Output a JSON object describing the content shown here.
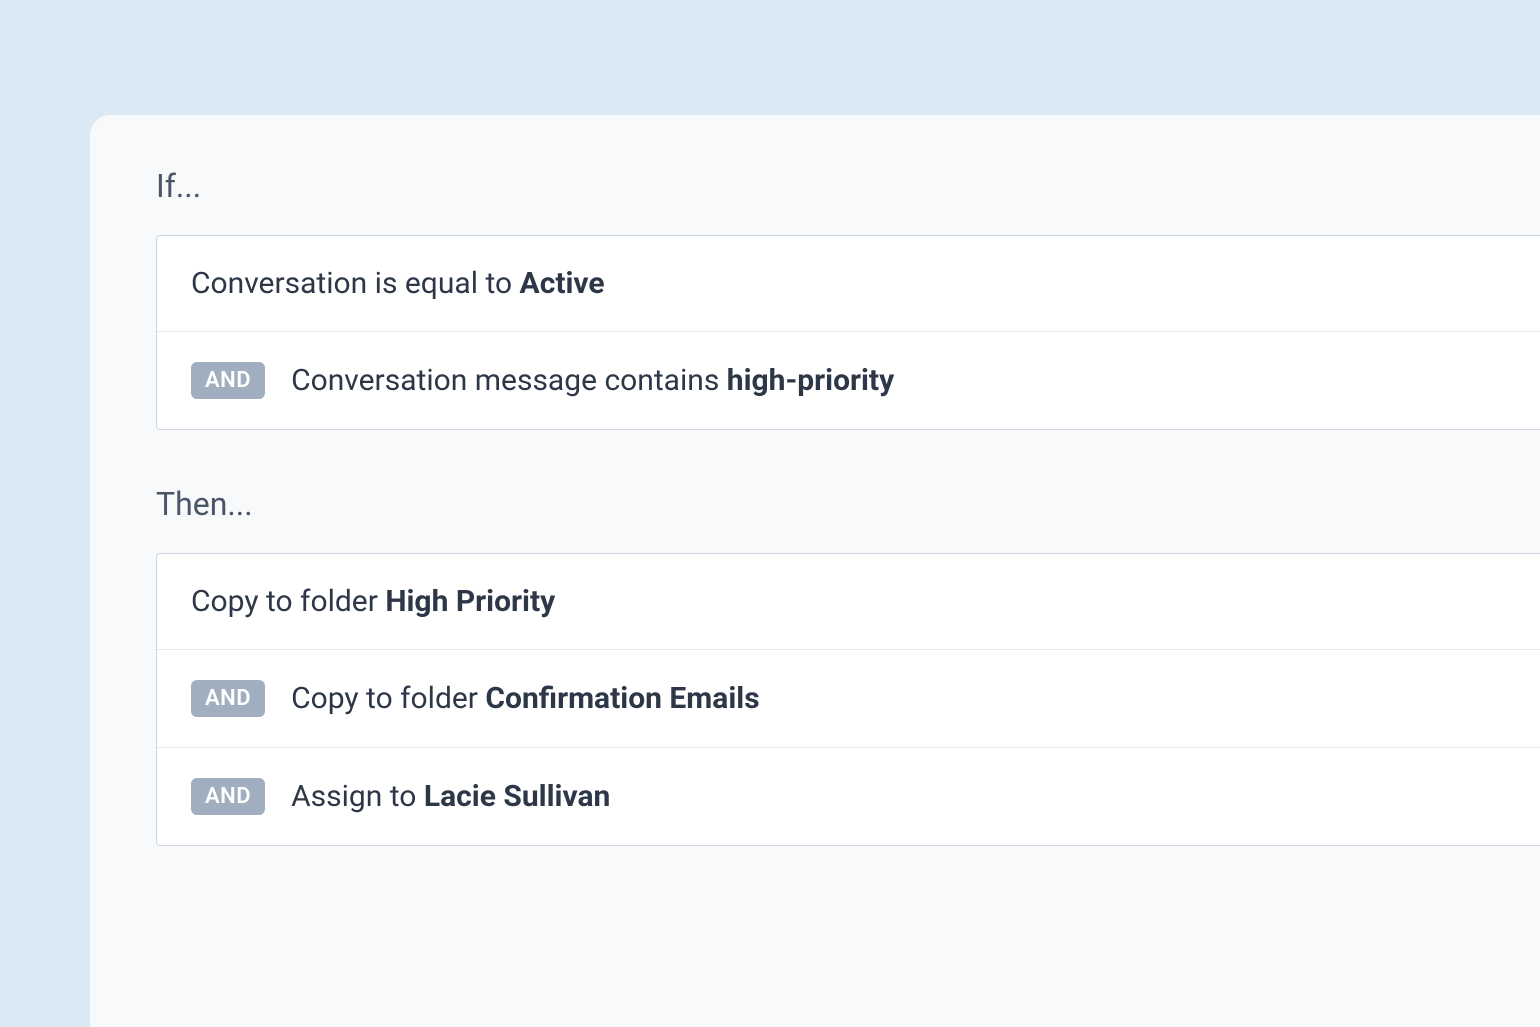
{
  "if": {
    "label": "If...",
    "conditions": [
      {
        "operator": null,
        "subject": "Conversation",
        "predicate": "is equal to",
        "value": "Active"
      },
      {
        "operator": "AND",
        "subject": "Conversation message",
        "predicate": "contains",
        "value": "high-priority"
      }
    ]
  },
  "then": {
    "label": "Then...",
    "actions": [
      {
        "operator": null,
        "action": "Copy to folder",
        "value": "High Priority"
      },
      {
        "operator": "AND",
        "action": "Copy to folder",
        "value": "Confirmation Emails"
      },
      {
        "operator": "AND",
        "action": "Assign to",
        "value": "Lacie Sullivan"
      }
    ]
  }
}
